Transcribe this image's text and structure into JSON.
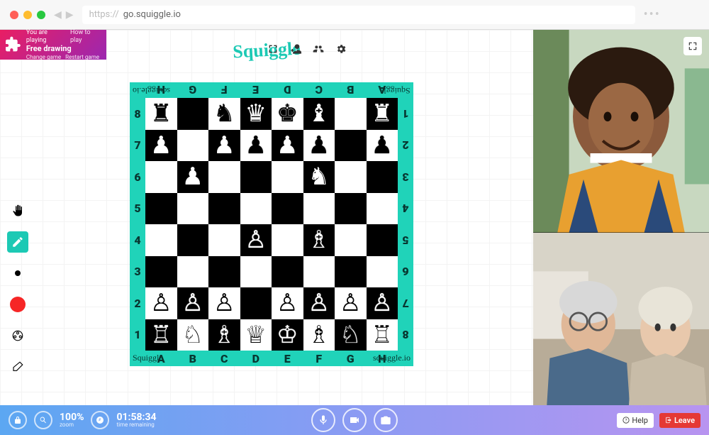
{
  "browser": {
    "protocol": "https://",
    "url": "go.squiggle.io"
  },
  "brand": "Squiggle",
  "game_badge": {
    "subtitle": "You are playing",
    "title": "Free drawing",
    "how": "How to play",
    "change": "Change game",
    "restart": "Restart game"
  },
  "top_controls": [
    "fullscreen",
    "add-user",
    "users",
    "settings"
  ],
  "left_tools": [
    "hand",
    "pencil",
    "stroke",
    "color",
    "picker",
    "eraser"
  ],
  "chess": {
    "files": [
      "A",
      "B",
      "C",
      "D",
      "E",
      "F",
      "G",
      "H"
    ],
    "ranks": [
      "8",
      "7",
      "6",
      "5",
      "4",
      "3",
      "2",
      "1"
    ],
    "brand_small": "Squiggle",
    "domain": "squiggle.io",
    "position": [
      [
        "r",
        ".",
        "n",
        "q",
        "k",
        "b",
        ".",
        "r"
      ],
      [
        "p",
        ".",
        "p",
        "p",
        "p",
        "p",
        ".",
        "p"
      ],
      [
        ".",
        "p",
        ".",
        ".",
        ".",
        "n",
        ".",
        "."
      ],
      [
        ".",
        ".",
        ".",
        ".",
        ".",
        ".",
        ".",
        "."
      ],
      [
        ".",
        ".",
        ".",
        "P",
        ".",
        "B",
        ".",
        "."
      ],
      [
        ".",
        ".",
        ".",
        ".",
        ".",
        ".",
        ".",
        "."
      ],
      [
        "P",
        "P",
        "P",
        ".",
        "P",
        "P",
        "P",
        "P"
      ],
      [
        "R",
        "N",
        "B",
        "Q",
        "K",
        "B",
        "N",
        "R"
      ]
    ]
  },
  "bottom": {
    "zoom_value": "100%",
    "zoom_label": "zoom",
    "time_value": "01:58:34",
    "time_label": "time remaining",
    "help": "Help",
    "leave": "Leave"
  }
}
